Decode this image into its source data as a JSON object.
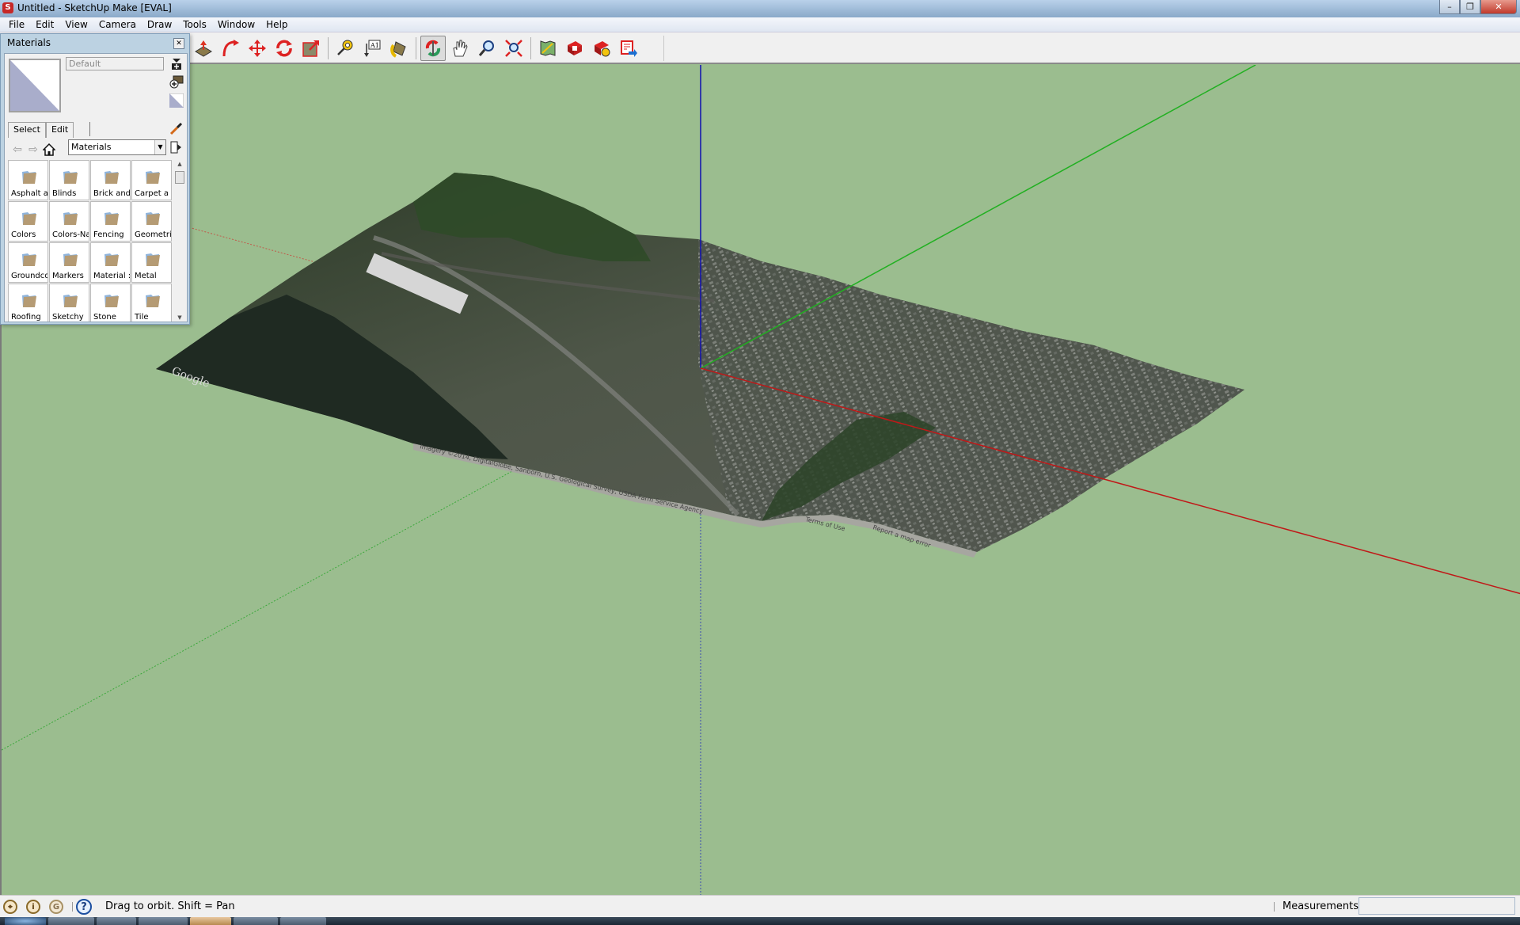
{
  "window": {
    "title": "Untitled - SketchUp Make [EVAL]",
    "app_icon": "sketchup-logo-icon",
    "controls": {
      "minimize": "–",
      "maximize": "❐",
      "close": "✕"
    }
  },
  "menubar": {
    "items": [
      {
        "label": "File",
        "mnemonic": "F"
      },
      {
        "label": "Edit",
        "mnemonic": "E"
      },
      {
        "label": "View",
        "mnemonic": "V"
      },
      {
        "label": "Camera",
        "mnemonic": "C"
      },
      {
        "label": "Draw",
        "mnemonic": "r"
      },
      {
        "label": "Tools",
        "mnemonic": "T"
      },
      {
        "label": "Window",
        "mnemonic": "W"
      },
      {
        "label": "Help",
        "mnemonic": "H"
      }
    ]
  },
  "toolbar": {
    "tools": [
      {
        "name": "push-pull-tool",
        "icon": "push-pull-icon"
      },
      {
        "name": "follow-me-tool",
        "icon": "follow-me-icon"
      },
      {
        "name": "move-tool",
        "icon": "move-icon"
      },
      {
        "name": "rotate-tool",
        "icon": "rotate-icon"
      },
      {
        "name": "scale-tool",
        "icon": "scale-icon"
      },
      {
        "name": "tape-measure-tool",
        "icon": "tape-measure-icon"
      },
      {
        "name": "text-tool",
        "icon": "text-label-icon"
      },
      {
        "name": "paint-bucket-tool",
        "icon": "paint-bucket-icon"
      },
      {
        "name": "orbit-tool",
        "icon": "orbit-icon",
        "active": true
      },
      {
        "name": "pan-tool",
        "icon": "pan-hand-icon"
      },
      {
        "name": "zoom-tool",
        "icon": "zoom-icon"
      },
      {
        "name": "zoom-extents-tool",
        "icon": "zoom-extents-icon"
      },
      {
        "name": "add-location-tool",
        "icon": "add-location-icon"
      },
      {
        "name": "get-models-tool",
        "icon": "get-models-icon"
      },
      {
        "name": "share-model-tool",
        "icon": "share-model-icon"
      },
      {
        "name": "send-to-layout-tool",
        "icon": "send-to-layout-icon"
      }
    ]
  },
  "materials_panel": {
    "title": "Materials",
    "current_material": "Default",
    "tabs": [
      {
        "label": "Select",
        "active": true
      },
      {
        "label": "Edit",
        "active": false
      }
    ],
    "library": "Materials",
    "folders": [
      "Asphalt a",
      "Blinds",
      "Brick and",
      "Carpet a",
      "Colors",
      "Colors-Na",
      "Fencing",
      "Geometri",
      "Groundco",
      "Markers",
      "Material :",
      "Metal",
      "Roofing",
      "Sketchy",
      "Stone",
      "Tile"
    ]
  },
  "viewport": {
    "background_color": "#9bbd8f",
    "axis_colors": {
      "red": "#c01818",
      "green": "#22b022",
      "blue": "#1010b0"
    },
    "terrain": {
      "watermark": "Google",
      "attribution": "Imagery ©2014, DigitalGlobe, Sanborn, U.S. Geological Survey, USDA Farm Service Agency",
      "links": [
        "Terms of Use",
        "Report a map error"
      ]
    }
  },
  "statusbar": {
    "icons": [
      "geo-location-icon",
      "credits-person-icon",
      "google-icon"
    ],
    "hint": "Drag to orbit.  Shift = Pan",
    "measurements_label": "Measurements",
    "measurements_value": ""
  }
}
